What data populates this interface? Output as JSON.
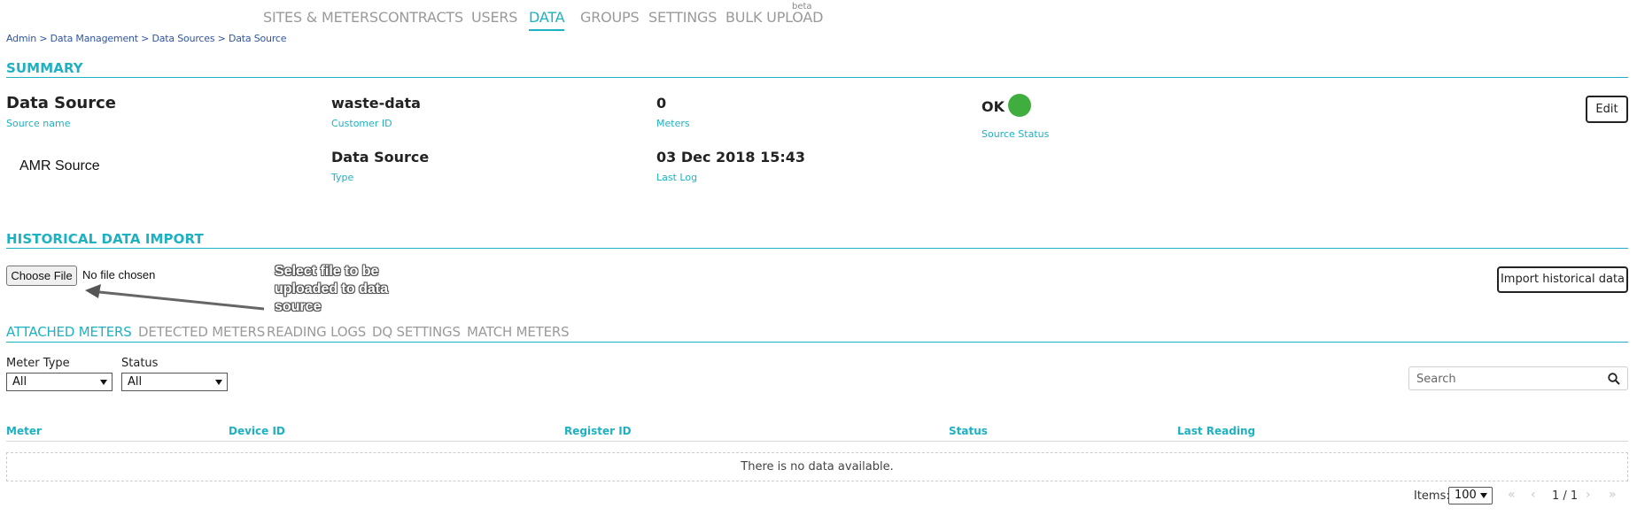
{
  "nav": {
    "items": [
      "SITES & METERS",
      "CONTRACTS",
      "USERS",
      "DATA",
      "GROUPS",
      "SETTINGS",
      "BULK UPLOAD"
    ],
    "active": "DATA",
    "beta_label": "beta"
  },
  "breadcrumb": "Admin > Data Management > Data Sources > Data Source",
  "summary": {
    "title": "SUMMARY",
    "source_name": {
      "value": "Data Source",
      "label": "Source name"
    },
    "customer_id": {
      "value": "waste-data",
      "label": "Customer ID"
    },
    "meters": {
      "value": "0",
      "label": "Meters"
    },
    "source_status": {
      "value": "OK",
      "label": "Source Status",
      "color": "#3fae3f"
    },
    "amr_source": "AMR Source",
    "type": {
      "value": "Data Source",
      "label": "Type"
    },
    "last_log": {
      "value": "03 Dec 2018 15:43",
      "label": "Last Log"
    },
    "edit_label": "Edit"
  },
  "import": {
    "title": "HISTORICAL DATA IMPORT",
    "choose_file_label": "Choose File",
    "no_file_text": "No file chosen",
    "callout": "Select file to be uploaded to data source",
    "import_button": "Import historical data"
  },
  "tabs": [
    "ATTACHED METERS",
    "DETECTED METERS",
    "READING LOGS",
    "DQ SETTINGS",
    "MATCH METERS"
  ],
  "filters": {
    "meter_type": {
      "label": "Meter Type",
      "value": "All"
    },
    "status": {
      "label": "Status",
      "value": "All"
    }
  },
  "search": {
    "placeholder": "Search",
    "icon": "search-icon"
  },
  "table": {
    "columns": [
      "Meter",
      "Device ID",
      "Register ID",
      "Status",
      "Last Reading"
    ],
    "empty_text": "There is no data available."
  },
  "pager": {
    "items_label": "Items:",
    "page_size": "100",
    "pages": "1 / 1"
  },
  "colors": {
    "accent": "#1eb1c2",
    "link": "#2f55a4",
    "status_ok": "#3fae3f"
  }
}
